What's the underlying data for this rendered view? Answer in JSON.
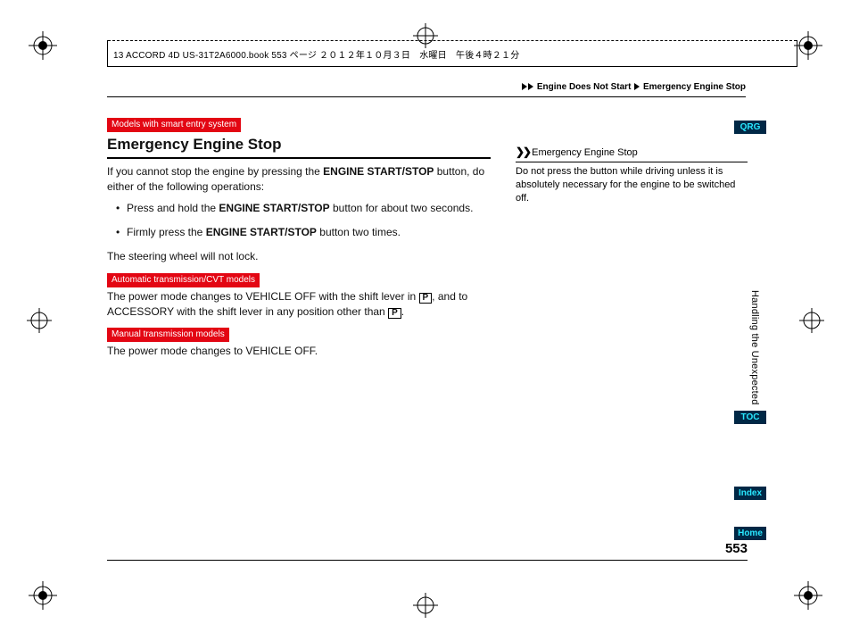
{
  "book_header": "13 ACCORD 4D US-31T2A6000.book  553 ページ  ２０１２年１０月３日　水曜日　午後４時２１分",
  "breadcrumb": {
    "a": "Engine Does Not Start",
    "b": "Emergency Engine Stop"
  },
  "tags": {
    "smart": "Models with smart entry system",
    "auto": "Automatic transmission/CVT models",
    "manual": "Manual transmission models"
  },
  "title": "Emergency Engine Stop",
  "intro_a": "If you cannot stop the engine by pressing the ",
  "intro_b": "ENGINE START/STOP",
  "intro_c": " button, do either of the following operations:",
  "b1_a": "Press and hold the ",
  "b1_b": "ENGINE START/STOP",
  "b1_c": " button for about two seconds.",
  "b2_a": "Firmly press the ",
  "b2_b": "ENGINE START/STOP",
  "b2_c": " button two times.",
  "steer": "The steering wheel will not lock.",
  "auto_a": "The power mode changes to VEHICLE OFF with the shift lever in ",
  "auto_key1": "P",
  "auto_b": ", and to ACCESSORY with the shift lever in any position other than ",
  "auto_key2": "P",
  "auto_c": ".",
  "manual_txt": "The power mode changes to VEHICLE OFF.",
  "note_head": "Emergency Engine Stop",
  "note_body": "Do not press the button while driving unless it is absolutely necessary for the engine to be switched off.",
  "tabs": {
    "qrg": "QRG",
    "toc": "TOC",
    "index": "Index",
    "home": "Home"
  },
  "chapter": "Handling the Unexpected",
  "page_number": "553"
}
